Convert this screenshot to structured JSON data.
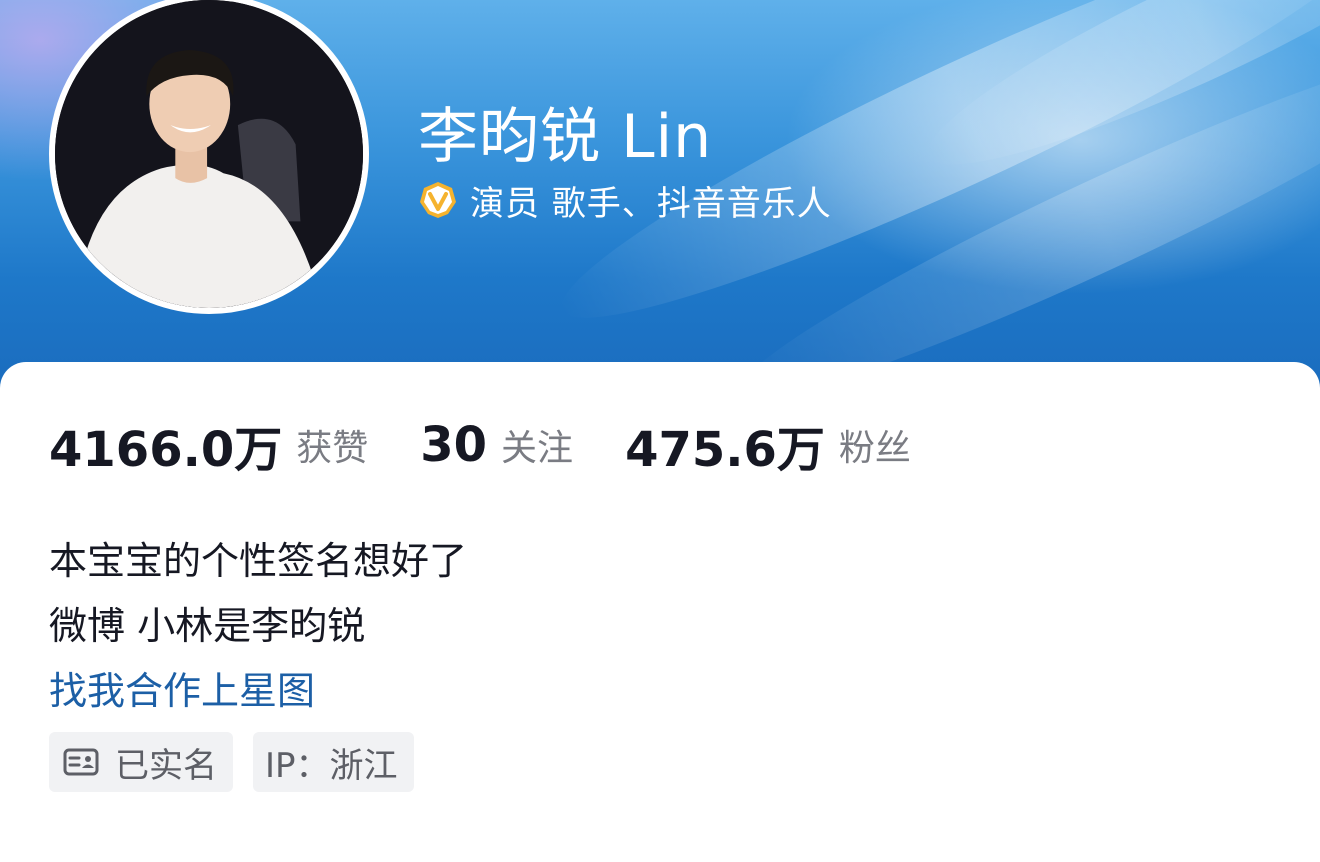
{
  "profile": {
    "name": "李昀锐 Lin",
    "verification": "演员 歌手、抖音音乐人"
  },
  "stats": [
    {
      "value": "4166.0万",
      "label": "获赞"
    },
    {
      "value": "30",
      "label": "关注"
    },
    {
      "value": "475.6万",
      "label": "粉丝"
    }
  ],
  "bio": {
    "line1": "本宝宝的个性签名想好了",
    "line2": "微博 小林是李昀锐",
    "link": "找我合作上星图"
  },
  "tags": {
    "verified_name": "已实名",
    "ip": "IP：浙江"
  },
  "colors": {
    "banner_blue": "#1e78c9",
    "link_blue": "#1c5fa6",
    "verify_badge": "#f5b32e",
    "text_dark": "#161823",
    "text_gray": "#7a7c83"
  },
  "icons": {
    "verify": "verified-badge-icon",
    "id_card": "id-card-icon"
  }
}
